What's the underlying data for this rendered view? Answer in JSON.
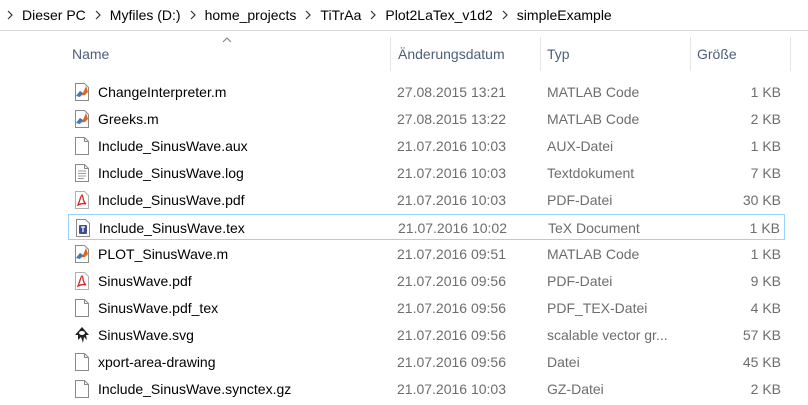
{
  "breadcrumb": [
    "Dieser PC",
    "Myfiles (D:)",
    "home_projects",
    "TiTrAa",
    "Plot2LaTex_v1d2",
    "simpleExample"
  ],
  "columns": {
    "name": "Name",
    "date": "Änderungsdatum",
    "type": "Typ",
    "size": "Größe"
  },
  "sort": {
    "column": "name",
    "direction": "ascending"
  },
  "files": [
    {
      "name": "ChangeInterpreter.m",
      "date": "27.08.2015 13:21",
      "type": "MATLAB Code",
      "size": "1 KB",
      "icon": "matlab-icon"
    },
    {
      "name": "Greeks.m",
      "date": "27.08.2015 13:22",
      "type": "MATLAB Code",
      "size": "2 KB",
      "icon": "matlab-icon"
    },
    {
      "name": "Include_SinusWave.aux",
      "date": "21.07.2016 10:03",
      "type": "AUX-Datei",
      "size": "1 KB",
      "icon": "blank-file-icon"
    },
    {
      "name": "Include_SinusWave.log",
      "date": "21.07.2016 10:03",
      "type": "Textdokument",
      "size": "7 KB",
      "icon": "text-file-icon"
    },
    {
      "name": "Include_SinusWave.pdf",
      "date": "21.07.2016 10:03",
      "type": "PDF-Datei",
      "size": "30 KB",
      "icon": "pdf-icon"
    },
    {
      "name": "Include_SinusWave.tex",
      "date": "21.07.2016 10:02",
      "type": "TeX Document",
      "size": "1 KB",
      "icon": "tex-icon",
      "selected": true
    },
    {
      "name": "PLOT_SinusWave.m",
      "date": "21.07.2016 09:51",
      "type": "MATLAB Code",
      "size": "1 KB",
      "icon": "matlab-icon"
    },
    {
      "name": "SinusWave.pdf",
      "date": "21.07.2016 09:56",
      "type": "PDF-Datei",
      "size": "9 KB",
      "icon": "pdf-icon"
    },
    {
      "name": "SinusWave.pdf_tex",
      "date": "21.07.2016 09:56",
      "type": "PDF_TEX-Datei",
      "size": "4 KB",
      "icon": "blank-file-icon"
    },
    {
      "name": "SinusWave.svg",
      "date": "21.07.2016 09:56",
      "type": "scalable vector gr...",
      "size": "57 KB",
      "icon": "inkscape-icon"
    },
    {
      "name": "xport-area-drawing",
      "date": "21.07.2016 09:56",
      "type": "Datei",
      "size": "45 KB",
      "icon": "blank-file-icon"
    },
    {
      "name": "Include_SinusWave.synctex.gz",
      "date": "21.07.2016 10:03",
      "type": "GZ-Datei",
      "size": "2 KB",
      "icon": "blank-file-icon"
    }
  ],
  "colors": {
    "header_text": "#4c607a",
    "detail_text": "#6d6d6d",
    "selection_border": "#99d1ff"
  }
}
